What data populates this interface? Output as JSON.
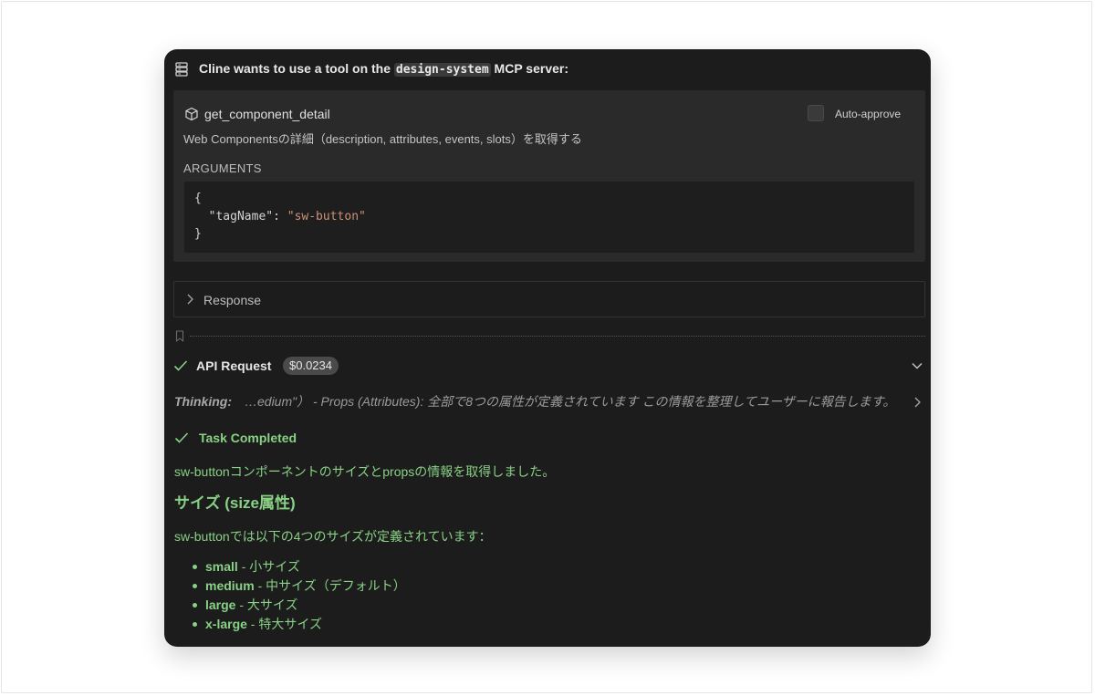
{
  "header": {
    "title_prefix": "Cline wants to use a tool on the ",
    "server_name": "design-system",
    "title_suffix": " MCP server:",
    "icon": "server-stack-icon"
  },
  "tool": {
    "name": "get_component_detail",
    "icon": "cube-icon",
    "auto_approve_label": "Auto-approve",
    "description": "Web Componentsの詳細（description, attributes, events, slots）を取得する",
    "arguments_label": "ARGUMENTS",
    "arguments": {
      "open": "{",
      "key": "  \"tagName\": ",
      "value": "\"sw-button\"",
      "close": "}"
    }
  },
  "response": {
    "label": "Response",
    "icon": "chevron-right-icon"
  },
  "api_request": {
    "title": "API Request",
    "cost": "$0.0234",
    "status_icon": "checkmark-icon",
    "collapse_icon": "chevron-down-icon"
  },
  "thinking": {
    "label": "Thinking:",
    "text": "…edium\"） - Props (Attributes): 全部で8つの属性が定義されています この情報を整理してユーザーに報告します。"
  },
  "task": {
    "title": "Task Completed",
    "intro": "sw-buttonコンポーネントのサイズとpropsの情報を取得しました。",
    "heading": "サイズ (size属性)",
    "sizes_intro": "sw-buttonでは以下の4つのサイズが定義されています：",
    "sizes": [
      {
        "name": "small",
        "desc": " - 小サイズ"
      },
      {
        "name": "medium",
        "desc": " - 中サイズ（デフォルト）"
      },
      {
        "name": "large",
        "desc": " - 大サイズ"
      },
      {
        "name": "x-large",
        "desc": " - 特大サイズ"
      }
    ]
  },
  "colors": {
    "panel_bg": "#1c1c1c",
    "card_bg": "#2a2a2a",
    "success_green": "#89d185",
    "string_orange": "#ce9178"
  }
}
